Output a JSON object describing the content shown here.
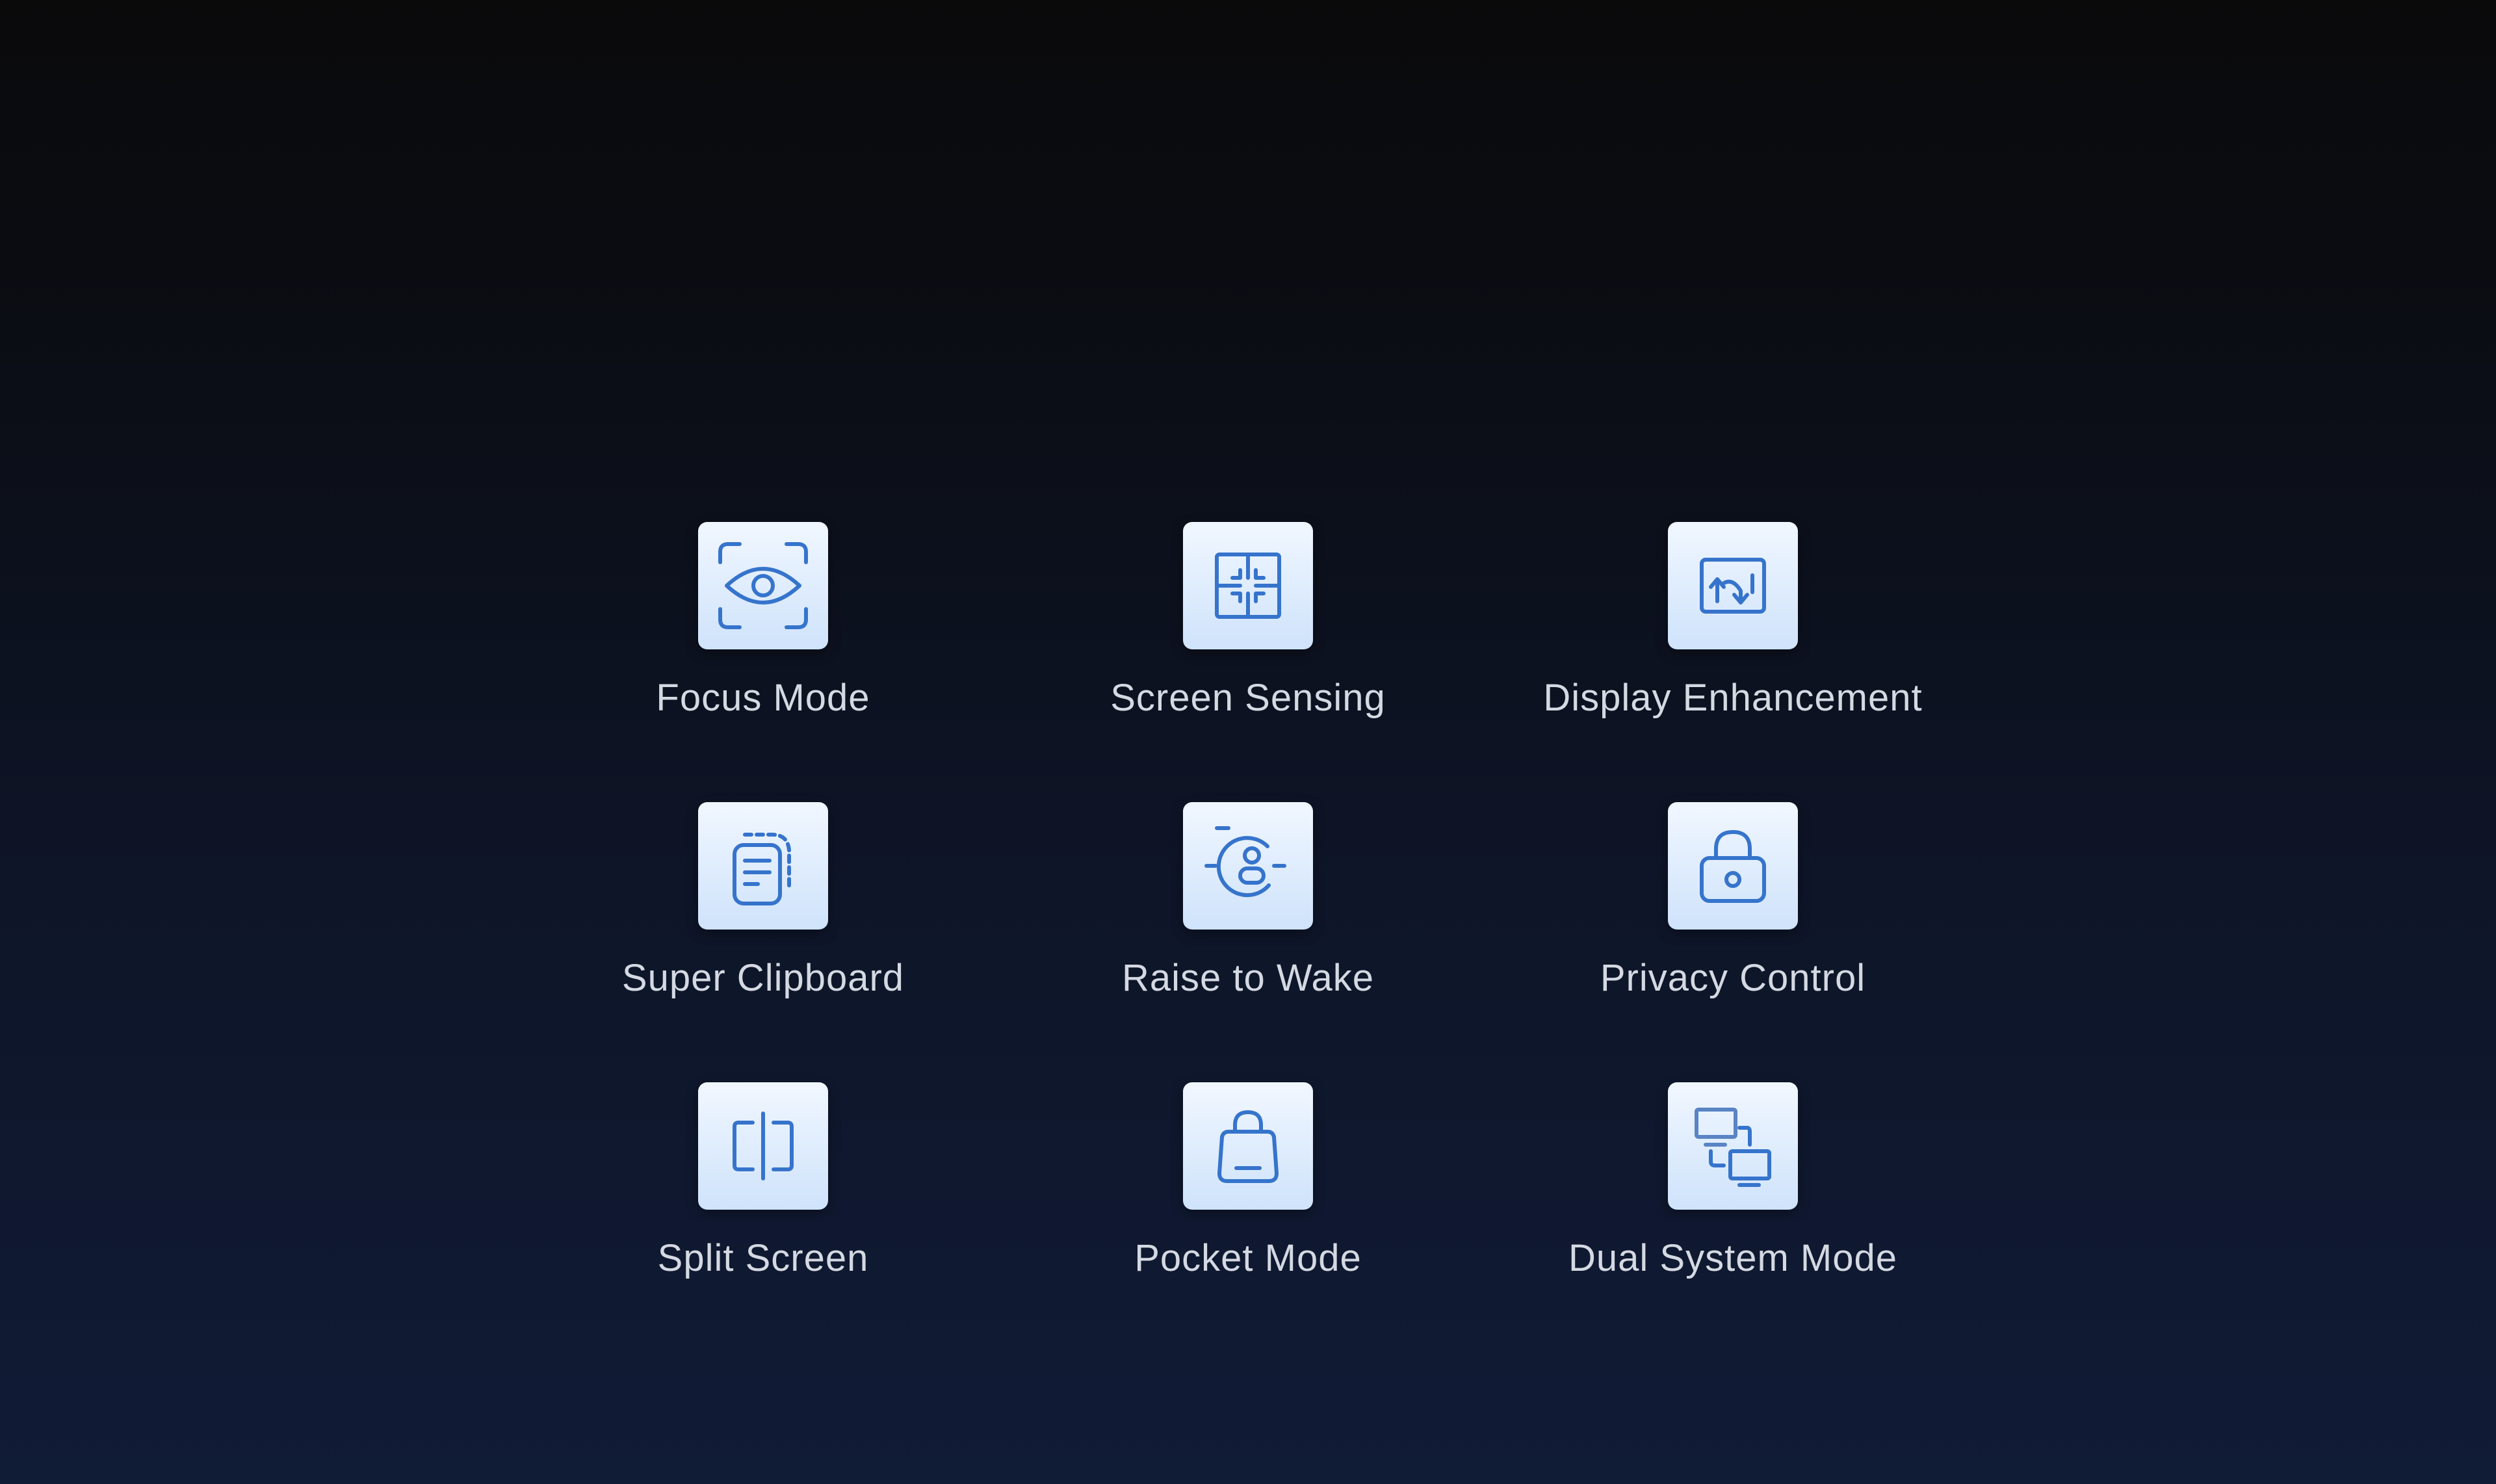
{
  "colors": {
    "icon_stroke": "#3674cc",
    "tile_top": "#f1f7ff",
    "tile_bottom": "#cfe3fb",
    "label": "#d4d9e2"
  },
  "features": [
    {
      "label": "Focus Mode",
      "icon": "eye-focus-icon"
    },
    {
      "label": "Screen Sensing",
      "icon": "screen-grid-icon"
    },
    {
      "label": "Display Enhancement",
      "icon": "display-arrows-icon"
    },
    {
      "label": "Super Clipboard",
      "icon": "clipboard-icon"
    },
    {
      "label": "Raise to Wake",
      "icon": "raise-wake-icon"
    },
    {
      "label": "Privacy Control",
      "icon": "padlock-icon"
    },
    {
      "label": "Split Screen",
      "icon": "split-screen-icon"
    },
    {
      "label": "Pocket Mode",
      "icon": "bag-icon"
    },
    {
      "label": "Dual System Mode",
      "icon": "dual-monitor-icon"
    }
  ]
}
